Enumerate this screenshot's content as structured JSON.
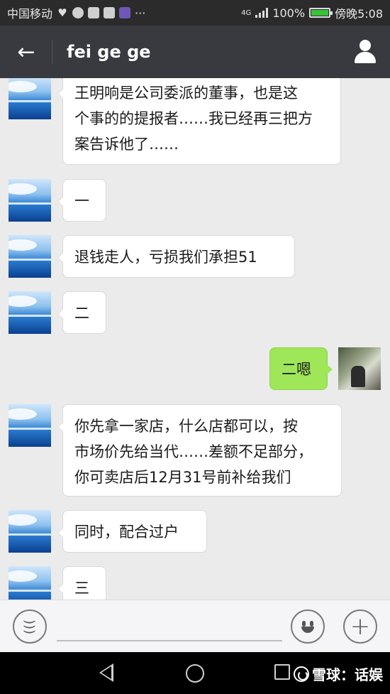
{
  "status_bar": {
    "carrier": "中国移动",
    "network": "4G",
    "battery": "100%",
    "time": "傍晚5:08",
    "battery_level": 1.0
  },
  "header": {
    "title": "fei ge ge",
    "back_icon": "back-arrow-icon",
    "profile_icon": "person-icon"
  },
  "messages": [
    {
      "side": "left",
      "text": "王明响是公司委派的董事，也是这\n个事的的提报者……我已经再三把方\n案告诉他了……"
    },
    {
      "side": "left",
      "text": "一"
    },
    {
      "side": "left",
      "text": "退钱走人，亏损我们承担51"
    },
    {
      "side": "left",
      "text": "二"
    },
    {
      "side": "right",
      "text": "二嗯"
    },
    {
      "side": "left",
      "text": "你先拿一家店，什么店都可以，按\n市场价先给当代……差额不足部分，\n你可卖店后12月31号前补给我们"
    },
    {
      "side": "left",
      "text": "同时，配合过户"
    },
    {
      "side": "left",
      "text": "三"
    }
  ],
  "input_bar": {
    "voice_icon": "voice-icon",
    "emoji_icon": "emoji-icon",
    "plus_icon": "plus-icon",
    "plus_glyph": "+"
  },
  "watermark": {
    "text": "雪球：话娱"
  },
  "colors": {
    "header_bg": "#393a3f",
    "chat_bg": "#ebebeb",
    "my_bubble": "#9fe658",
    "their_bubble": "#ffffff"
  }
}
